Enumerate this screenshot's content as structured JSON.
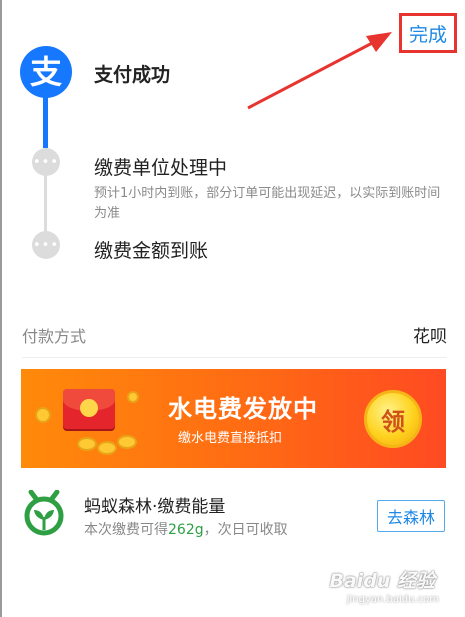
{
  "header": {
    "done_label": "完成"
  },
  "timeline": {
    "logo_glyph": "支",
    "steps": [
      {
        "title": "支付成功",
        "desc": ""
      },
      {
        "title": "缴费单位处理中",
        "desc": "预计1小时内到账，部分订单可能出现延迟，以实际到账时间为准"
      },
      {
        "title": "缴费金额到账",
        "desc": ""
      }
    ],
    "dot_glyph": "•••"
  },
  "payment": {
    "label": "付款方式",
    "value": "花呗"
  },
  "banner": {
    "title": "水电费发放中",
    "subtitle": "缴水电费直接抵扣",
    "claim_label": "领"
  },
  "forest": {
    "title": "蚂蚁森林·缴费能量",
    "desc_prefix": "本次缴费可得",
    "energy": "262g",
    "desc_suffix": "，次日可收取",
    "button_label": "去森林"
  },
  "watermark": {
    "brand": "Baidu 经验",
    "url": "jingyan.baidu.com"
  },
  "colors": {
    "brand_blue": "#1677ff",
    "annotation_red": "#e8342f",
    "energy_green": "#2ea043",
    "banner_orange": "#ff6a14"
  }
}
